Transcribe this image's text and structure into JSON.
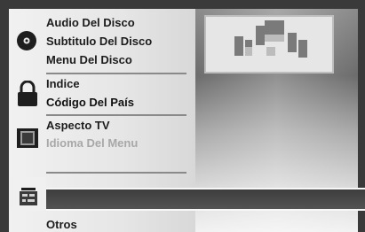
{
  "menu": {
    "disc_group": {
      "icon": "disc-icon",
      "items": [
        {
          "label": "Audio Del Disco"
        },
        {
          "label": "Subtitulo Del Disco"
        },
        {
          "label": "Menu Del Disco"
        }
      ]
    },
    "lock_group": {
      "icon": "lock-icon",
      "items": [
        {
          "label": "Indice"
        },
        {
          "label": "Código Del País",
          "selected": true
        }
      ]
    },
    "tv_group": {
      "icon": "tv-screen-icon",
      "items": [
        {
          "label": "Aspecto TV"
        },
        {
          "label": "Idioma Del Menu",
          "dimmed": true
        }
      ]
    },
    "other_group": {
      "icon": "settings-panel-icon",
      "items": [
        {
          "label": "Otros"
        }
      ]
    }
  },
  "colors": {
    "panel": "#ececec",
    "background": "#3a3a3a",
    "divider": "#8a8a8a",
    "text": "#1c1c1c",
    "dim_text": "#a8a8a8"
  }
}
